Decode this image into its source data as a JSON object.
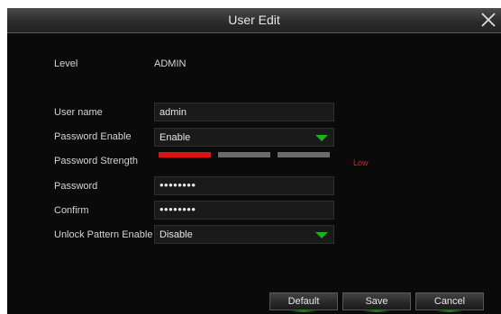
{
  "window": {
    "title": "User Edit"
  },
  "form": {
    "level_label": "Level",
    "level_value": "ADMIN",
    "username_label": "User name",
    "username_value": "admin",
    "password_enable_label": "Password Enable",
    "password_enable_value": "Enable",
    "password_strength_label": "Password Strength",
    "password_strength_text": "Low",
    "password_strength_level": 1,
    "password_strength_max": 3,
    "password_label": "Password",
    "password_value": "••••••••",
    "confirm_label": "Confirm",
    "confirm_value": "••••••••",
    "unlock_pattern_label": "Unlock Pattern Enable",
    "unlock_pattern_value": "Disable"
  },
  "buttons": {
    "default_label": "Default",
    "save_label": "Save",
    "cancel_label": "Cancel"
  },
  "colors": {
    "strength_active": "#e01010",
    "strength_inactive": "#6a6a6a",
    "dropdown_arrow": "#19b219",
    "background": "#0a0a0a"
  }
}
